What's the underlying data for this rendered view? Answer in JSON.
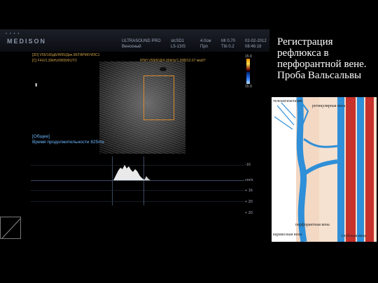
{
  "header": {
    "brand": "MEDISON",
    "mode": "ULTRASOUND PRO",
    "study": "Венозный",
    "preset_id": "slcSD1",
    "probe": "L5-13IS",
    "depth": "4.0см",
    "depth_unit": "Прп",
    "mi": "MI 0.70",
    "tib": "TIb 0.2",
    "date": "02-02-2012",
    "time": "08:46:18"
  },
  "params": {
    "line_2d": "[2D] V55/100дБ/W65/Дин.90/ГАРМ/УИЗС1",
    "line_c": "[C] F4U/1.30kHz/W65/Ф1/Т2",
    "line_pw": "[PW] V58/60Д/4.00kHz/1.50В/12.67 мм/0°"
  },
  "scale_labels": [
    "15.9",
    "cm/s",
    "15.9"
  ],
  "info": {
    "heading": "[Общее]",
    "line": "Время продолжительности 825ms"
  },
  "doppler_axis": [
    "-16",
    "cm/s",
    "+ 16",
    "+ 20",
    "+ 20"
  ],
  "slide": {
    "title": "Регистрация рефлюкса в перфорантной вене. Проба Вальсальвы"
  },
  "diagram_labels": {
    "telangiectasia": "телеангиэктазия",
    "reticular": "ретикулярная вена",
    "varicose": "варикозная вена",
    "perforating": "перфорантная вена",
    "deep": "глубокая вена"
  },
  "colors": {
    "accent_orange": "#d78b2f",
    "info_blue": "#6fb9ff",
    "vein_blue": "#2f8fd8",
    "artery_red": "#c8322d"
  }
}
